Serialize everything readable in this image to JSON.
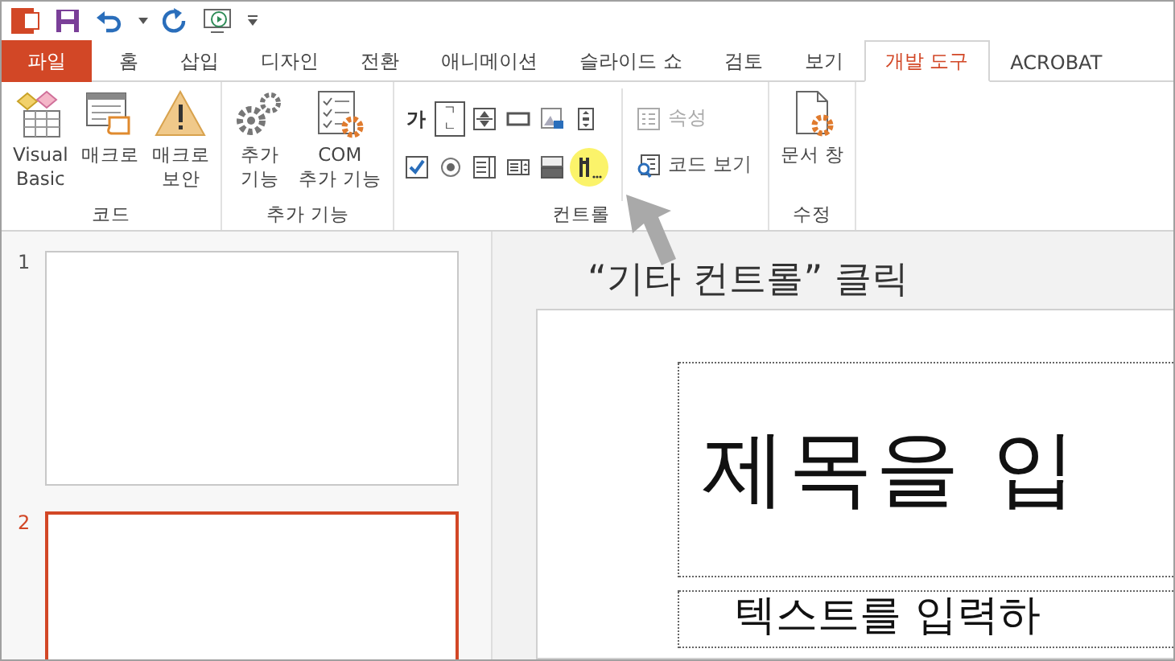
{
  "tabs": [
    {
      "label": "파일",
      "kind": "file",
      "selected": false
    },
    {
      "label": "홈",
      "kind": "tab",
      "selected": false
    },
    {
      "label": "삽입",
      "kind": "tab",
      "selected": false
    },
    {
      "label": "디자인",
      "kind": "tab",
      "selected": false
    },
    {
      "label": "전환",
      "kind": "tab",
      "selected": false
    },
    {
      "label": "애니메이션",
      "kind": "tab",
      "selected": false
    },
    {
      "label": "슬라이드 쇼",
      "kind": "tab",
      "selected": false
    },
    {
      "label": "검토",
      "kind": "tab",
      "selected": false
    },
    {
      "label": "보기",
      "kind": "tab",
      "selected": false
    },
    {
      "label": "개발 도구",
      "kind": "tab",
      "selected": true
    },
    {
      "label": "ACROBAT",
      "kind": "tab",
      "selected": false
    }
  ],
  "ribbon": {
    "groups": [
      {
        "label": "코드",
        "kind": "large",
        "items": [
          {
            "kind": "vb",
            "lines": [
              "Visual",
              "Basic"
            ]
          },
          {
            "kind": "macro",
            "lines": [
              "매크로"
            ]
          },
          {
            "kind": "security",
            "lines": [
              "매크로",
              "보안"
            ]
          }
        ]
      },
      {
        "label": "추가 기능",
        "kind": "large",
        "items": [
          {
            "kind": "addins",
            "lines": [
              "추가",
              "기능"
            ]
          },
          {
            "kind": "com",
            "lines": [
              "COM",
              "추가 기능"
            ]
          }
        ]
      },
      {
        "label": "컨트롤",
        "kind": "controls",
        "rows": [
          [
            {
              "kind": "label",
              "text": "가"
            },
            {
              "kind": "textbox",
              "text": "ㄱㄴ"
            },
            {
              "kind": "spin"
            },
            {
              "kind": "button"
            },
            {
              "kind": "image"
            },
            {
              "kind": "scroll"
            }
          ],
          [
            {
              "kind": "checkbox"
            },
            {
              "kind": "radio"
            },
            {
              "kind": "listbox"
            },
            {
              "kind": "combobox"
            },
            {
              "kind": "toggle"
            },
            {
              "kind": "more",
              "highlighted": true
            }
          ]
        ],
        "side": [
          {
            "kind": "properties",
            "label": "속성",
            "disabled": true
          },
          {
            "kind": "viewcode",
            "label": "코드 보기",
            "disabled": false
          }
        ]
      },
      {
        "label": "수정",
        "kind": "large",
        "items": [
          {
            "kind": "docpane",
            "lines": [
              "문서 창"
            ]
          }
        ]
      }
    ]
  },
  "slides": [
    {
      "number": "1",
      "selected": false
    },
    {
      "number": "2",
      "selected": true
    }
  ],
  "annotation": {
    "text": "“기타 컨트롤” 클릭"
  },
  "slide": {
    "title": "제목을 입",
    "subtitle": "텍스트를 입력하"
  }
}
